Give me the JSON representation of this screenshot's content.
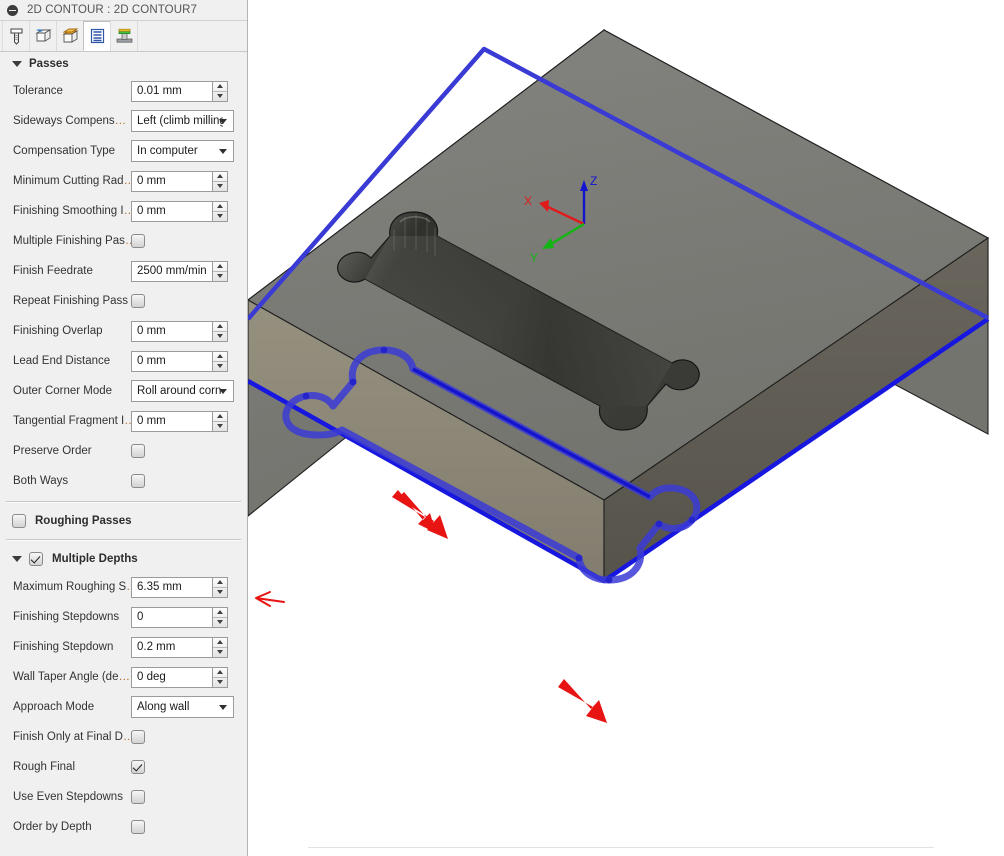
{
  "window": {
    "title": "2D CONTOUR : 2D CONTOUR7",
    "collapse_icon": "collapse-circle-icon"
  },
  "toolbar": {
    "tabs": [
      {
        "id": "tool",
        "icon": "endmill-tool-icon",
        "label": "Tool",
        "active": false
      },
      {
        "id": "geometry",
        "icon": "geometry-cube-icon",
        "label": "Geometry",
        "active": false
      },
      {
        "id": "heights",
        "icon": "heights-cube-icon",
        "label": "Heights",
        "active": false
      },
      {
        "id": "passes",
        "icon": "passes-layers-icon",
        "label": "Passes",
        "active": true
      },
      {
        "id": "linking",
        "icon": "linking-ramp-icon",
        "label": "Linking",
        "active": false
      }
    ]
  },
  "sections": [
    {
      "id": "passes",
      "type": "section",
      "title": "Passes",
      "expanded": true,
      "rows": [
        {
          "name": "tolerance",
          "label": "Tolerance",
          "control": "spinner",
          "value": "0.01 mm"
        },
        {
          "name": "sideways-compensation",
          "label": "Sideways Compens…",
          "truncated": true,
          "control": "combo",
          "value": "Left (climb milling)"
        },
        {
          "name": "compensation-type",
          "label": "Compensation Type",
          "control": "combo",
          "value": "In computer"
        },
        {
          "name": "minimum-cutting-radius",
          "label": "Minimum Cutting Rad…",
          "truncated": true,
          "control": "spinner",
          "value": "0 mm"
        },
        {
          "name": "finishing-smoothing-deviation",
          "label": "Finishing Smoothing I…",
          "truncated": true,
          "control": "spinner",
          "value": "0 mm"
        },
        {
          "name": "multiple-finishing-passes",
          "label": "Multiple Finishing Pas…",
          "truncated": true,
          "control": "checkbox",
          "checked": false
        },
        {
          "name": "finish-feedrate",
          "label": "Finish Feedrate",
          "control": "spinner",
          "value": "2500 mm/min"
        },
        {
          "name": "repeat-finishing-pass",
          "label": "Repeat Finishing Pass",
          "control": "checkbox",
          "checked": false
        },
        {
          "name": "finishing-overlap",
          "label": "Finishing Overlap",
          "control": "spinner",
          "value": "0 mm"
        },
        {
          "name": "lead-end-distance",
          "label": "Lead End Distance",
          "control": "spinner",
          "value": "0 mm"
        },
        {
          "name": "outer-corner-mode",
          "label": "Outer Corner Mode",
          "control": "combo",
          "value": "Roll around corn…"
        },
        {
          "name": "tangential-fragment",
          "label": "Tangential Fragment I…",
          "truncated": true,
          "control": "spinner",
          "value": "0 mm"
        },
        {
          "name": "preserve-order",
          "label": "Preserve Order",
          "control": "checkbox",
          "checked": false
        },
        {
          "name": "both-ways",
          "label": "Both Ways",
          "control": "checkbox",
          "checked": false
        }
      ]
    },
    {
      "id": "roughing-passes",
      "type": "group",
      "title": "Roughing Passes",
      "checked": false,
      "expanded": false,
      "rows": []
    },
    {
      "id": "multiple-depths",
      "type": "group",
      "title": "Multiple Depths",
      "checked": true,
      "expanded": true,
      "rows": [
        {
          "name": "maximum-roughing-stepdown",
          "label": "Maximum Roughing S…",
          "truncated": true,
          "control": "spinner",
          "value": "6.35 mm"
        },
        {
          "name": "finishing-stepdowns",
          "label": "Finishing Stepdowns",
          "control": "spinner",
          "value": "0"
        },
        {
          "name": "finishing-stepdown",
          "label": "Finishing Stepdown",
          "control": "spinner",
          "value": "0.2 mm"
        },
        {
          "name": "wall-taper-angle",
          "label": "Wall Taper Angle (de…",
          "truncated": true,
          "control": "spinner",
          "value": "0 deg"
        },
        {
          "name": "approach-mode",
          "label": "Approach Mode",
          "control": "combo",
          "value": "Along wall"
        },
        {
          "name": "finish-only-at-final-depth",
          "label": "Finish Only at Final D…",
          "truncated": true,
          "control": "checkbox",
          "checked": false
        },
        {
          "name": "rough-final",
          "label": "Rough Final",
          "control": "checkbox",
          "checked": true
        },
        {
          "name": "use-even-stepdowns",
          "label": "Use Even Stepdowns",
          "control": "checkbox",
          "checked": false
        },
        {
          "name": "order-by-depth",
          "label": "Order by Depth",
          "control": "checkbox",
          "checked": false
        }
      ]
    }
  ],
  "viewport": {
    "axes": {
      "x_label": "X",
      "y_label": "Y",
      "z_label": "Z",
      "x_color": "#e01b1b",
      "y_color": "#12b512",
      "z_color": "#1414cf"
    },
    "colors": {
      "stock_top": "#7b7b78",
      "stock_front_left": "#8d8679",
      "stock_front_right": "#605c54",
      "toolpath": "#2222dd",
      "toolpath_light": "#5a5ad8",
      "annotation_red": "#e81313",
      "background": "#ffffff"
    },
    "annotations": [
      {
        "name": "stepdown-callout-arrow",
        "type": "hand-drawn-arrow",
        "direction": "left",
        "points_at": "maximum-roughing-stepdown"
      },
      {
        "name": "toolpath-direction-arrow",
        "type": "solid-arrow",
        "direction": "down-right"
      },
      {
        "name": "stock-corner-arrow",
        "type": "solid-arrow",
        "direction": "up-left"
      }
    ],
    "model": {
      "name": "rectangular-stock-with-dogbone-slot-pocket",
      "toolpath_name": "2d-contour-toolpath"
    }
  }
}
